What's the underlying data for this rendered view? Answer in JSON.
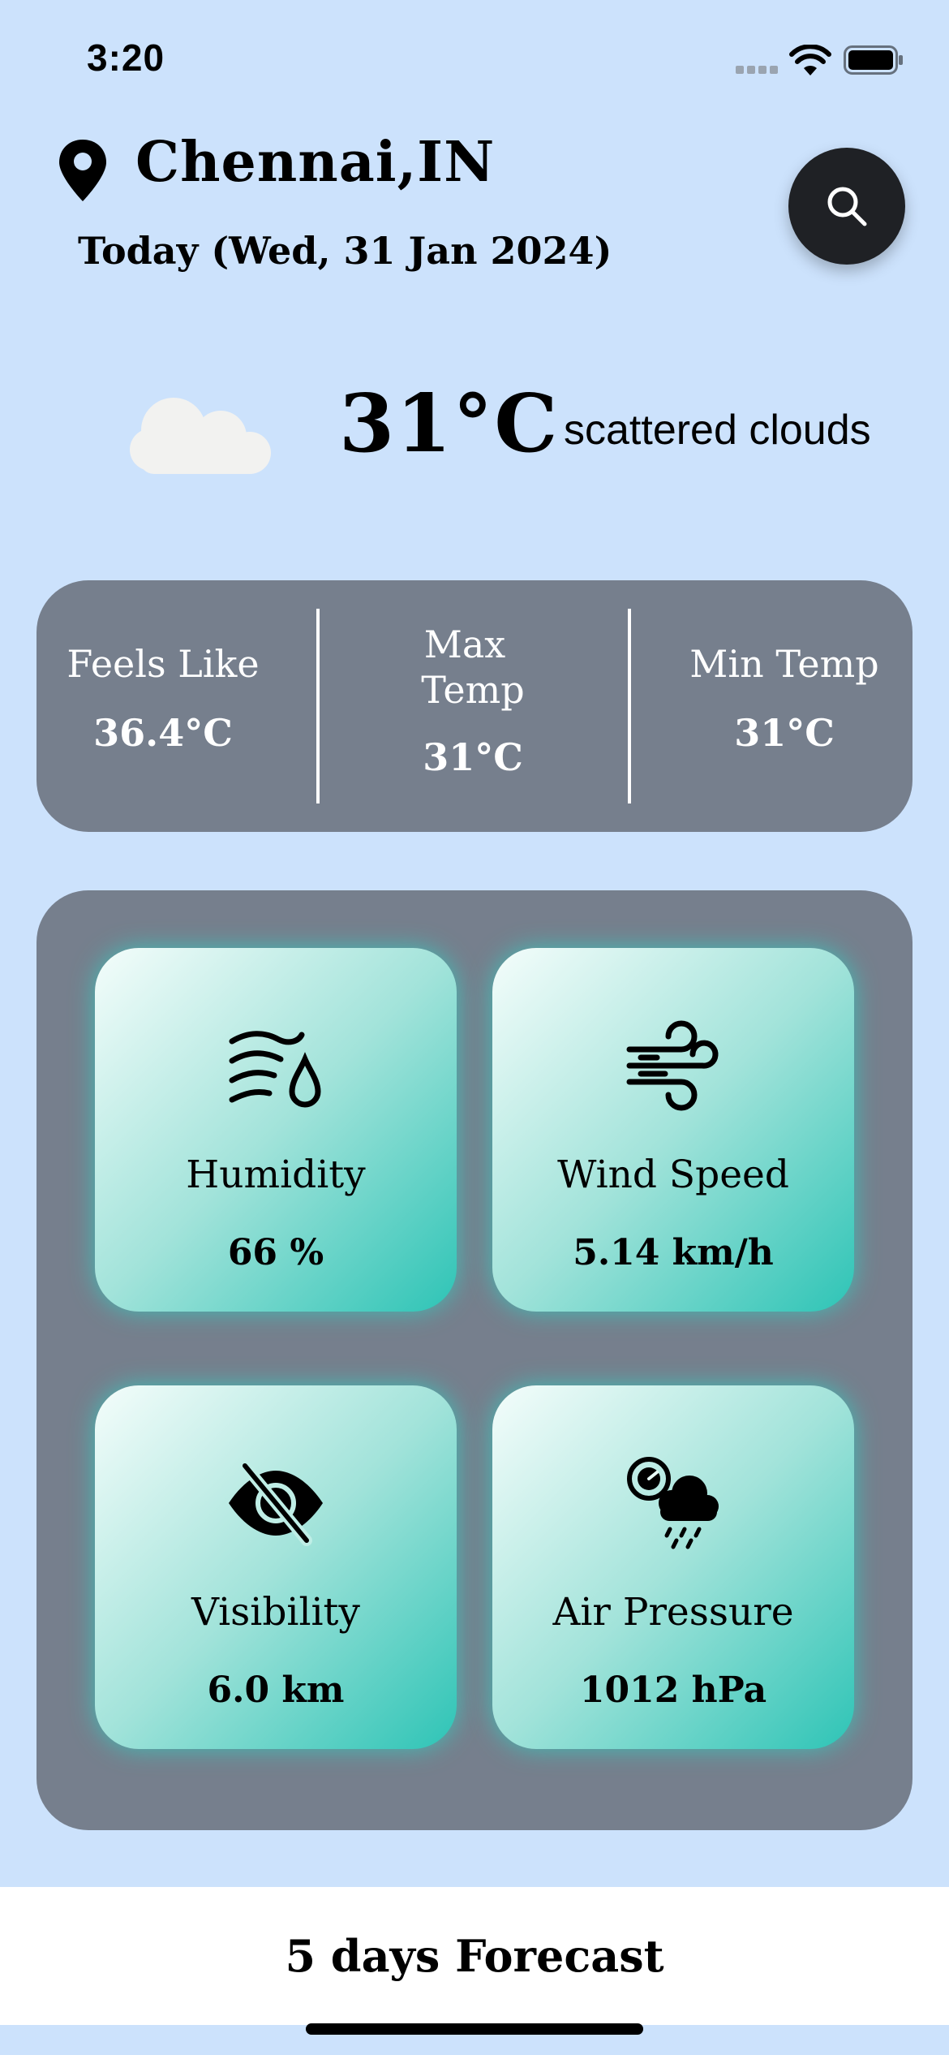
{
  "status_bar": {
    "time": "3:20"
  },
  "header": {
    "city": "Chennai,IN",
    "date": "Today (Wed, 31 Jan 2024)"
  },
  "current": {
    "temperature": "31°C",
    "description": "scattered clouds",
    "icon": "cloud-icon"
  },
  "temps": {
    "feels_like": {
      "label": "Feels Like",
      "value": "36.4°C"
    },
    "max": {
      "label_line1": "Max",
      "label_line2": "Temp",
      "value": "31°C"
    },
    "min": {
      "label": "Min Temp",
      "value": "31°C"
    }
  },
  "metrics": {
    "humidity": {
      "label": "Humidity",
      "value": "66 %",
      "icon": "humidity-icon"
    },
    "wind": {
      "label": "Wind Speed",
      "value": "5.14 km/h",
      "icon": "wind-icon"
    },
    "visibility": {
      "label": "Visibility",
      "value": "6.0 km",
      "icon": "visibility-off-icon"
    },
    "pressure": {
      "label": "Air Pressure",
      "value": "1012 hPa",
      "icon": "pressure-icon"
    }
  },
  "footer": {
    "forecast_label": "5 days Forecast"
  },
  "colors": {
    "background": "#cce2fc",
    "card": "#767f8d",
    "tile_accent": "#2ec4b6",
    "search_button": "#1f2125"
  }
}
